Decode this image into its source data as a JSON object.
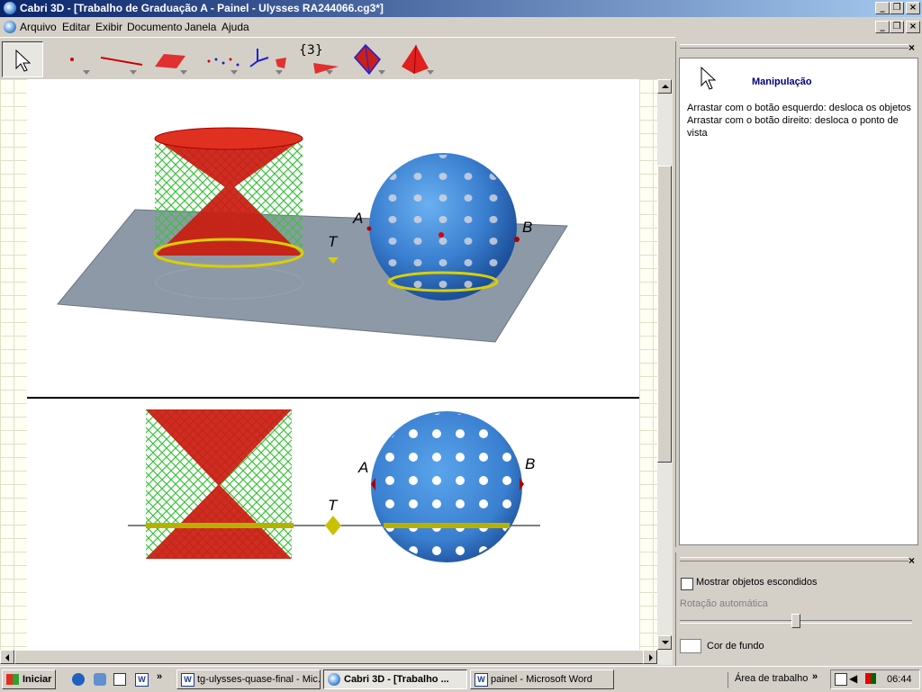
{
  "window": {
    "title": "Cabri 3D - [Trabalho de Graduação A - Painel - Ulysses RA244066.cg3*]"
  },
  "menu": [
    "Arquivo",
    "Editar",
    "Exibir",
    "Documento",
    "Janela",
    "Ajuda"
  ],
  "toolbar": {
    "icons": [
      "pointer-icon",
      "point-icon",
      "line-icon",
      "plane-icon",
      "curve-icon",
      "transform-icon",
      "calculator-icon",
      "polyhedron-icon",
      "pyramid-icon"
    ],
    "calc_label": "{3}"
  },
  "canvas": {
    "labels": {
      "a": "A",
      "b": "B",
      "t": "T"
    },
    "colors": {
      "plane": "#8e99a8",
      "sphere": "#3a7fd0",
      "cone": "#cc1a10",
      "net": "#3cc23c",
      "ring": "#d8d000"
    }
  },
  "help": {
    "title": "Manipulação",
    "line1": "Arrastar com o botão esquerdo: desloca os objetos",
    "line2": "Arrastar com o botão direito: desloca o ponto de vista"
  },
  "controls": {
    "show_hidden_label": "Mostrar objetos escondidos",
    "show_hidden_checked": false,
    "auto_rotation_label": "Rotação automática",
    "auto_rotation_value": 0.5,
    "bg_color_label": "Cor de fundo",
    "bg_color": "#ffffff"
  },
  "taskbar": {
    "start_label": "Iniciar",
    "tasks": [
      {
        "label": "tg-ulysses-quase-final - Mic...",
        "active": false
      },
      {
        "label": "Cabri 3D - [Trabalho ...",
        "active": true
      },
      {
        "label": "painel - Microsoft Word",
        "active": false
      }
    ],
    "desktop_label": "Área de trabalho",
    "time": "06:44"
  }
}
